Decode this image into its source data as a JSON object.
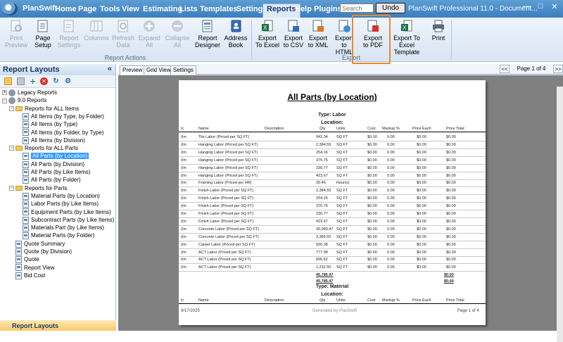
{
  "app": {
    "name": "PlanSwift",
    "window_title": "PlanSwift Professional 11.0 - Document...",
    "menu": [
      "Home",
      "Page",
      "Tools",
      "View",
      "Estimating",
      "Lists",
      "Templates",
      "Settings",
      "Reports",
      "Help",
      "Plugins"
    ],
    "search_placeholder": "Search",
    "undo_label": "Undo"
  },
  "ribbon": {
    "report_actions": {
      "label": "Report Actions",
      "buttons": [
        {
          "label": "Print Preview",
          "icon": "print-preview-icon",
          "disabled": true
        },
        {
          "label": "Page Setup",
          "icon": "page-setup-icon",
          "disabled": false
        },
        {
          "label": "Report Settings",
          "icon": "report-settings-icon",
          "disabled": true
        },
        {
          "label": "Columns",
          "icon": "columns-icon",
          "disabled": true
        },
        {
          "label": "Refresh Data",
          "icon": "refresh-icon",
          "disabled": true
        },
        {
          "label": "Expand All",
          "icon": "expand-all-icon",
          "disabled": true
        },
        {
          "label": "Collapse All",
          "icon": "collapse-all-icon",
          "disabled": true
        },
        {
          "label": "Report Designer",
          "icon": "report-designer-icon",
          "disabled": false
        },
        {
          "label": "Address Book",
          "icon": "address-book-icon",
          "disabled": false
        }
      ]
    },
    "export": {
      "label": "Export",
      "buttons": [
        {
          "label": "Export To Excel",
          "icon": "excel-icon"
        },
        {
          "label": "Export to CSV",
          "icon": "csv-icon"
        },
        {
          "label": "Export to XML",
          "icon": "xml-icon"
        },
        {
          "label": "Export to HTML",
          "icon": "html-icon"
        },
        {
          "label": "Export to PDF",
          "icon": "pdf-icon"
        },
        {
          "label": "Export To Excel Template",
          "icon": "excel-template-icon"
        },
        {
          "label": "Print",
          "icon": "printer-icon"
        }
      ]
    }
  },
  "left_pane": {
    "title": "Report Layouts",
    "bottom_label": "Report Layouts",
    "tree": [
      {
        "label": "Legacy Reports",
        "level": 0,
        "kind": "gear",
        "exp": "+"
      },
      {
        "label": "9.0 Reports",
        "level": 0,
        "kind": "gear",
        "exp": "-"
      },
      {
        "label": "Reports for ALL Items",
        "level": 1,
        "kind": "folder",
        "exp": "-"
      },
      {
        "label": "All Items (by Type, by Folder)",
        "level": 2,
        "kind": "doc"
      },
      {
        "label": "All Items (by Type)",
        "level": 2,
        "kind": "doc"
      },
      {
        "label": "All Items (by Folder, by Type)",
        "level": 2,
        "kind": "doc"
      },
      {
        "label": "All Items (by Division)",
        "level": 2,
        "kind": "doc"
      },
      {
        "label": "Reports for ALL Parts",
        "level": 1,
        "kind": "folder",
        "exp": "-"
      },
      {
        "label": "All Parts (by Location)",
        "level": 2,
        "kind": "doc",
        "selected": true
      },
      {
        "label": "All Parts (by Division)",
        "level": 2,
        "kind": "doc"
      },
      {
        "label": "All Parts (by Like Items)",
        "level": 2,
        "kind": "doc"
      },
      {
        "label": "All Parts (by Folder)",
        "level": 2,
        "kind": "doc"
      },
      {
        "label": "Reports for Parts",
        "level": 1,
        "kind": "folder",
        "exp": "-"
      },
      {
        "label": "Material Parts (by Location)",
        "level": 2,
        "kind": "doc"
      },
      {
        "label": "Labor Parts (by Like Items)",
        "level": 2,
        "kind": "doc"
      },
      {
        "label": "Equipment Parts (by Like Items)",
        "level": 2,
        "kind": "doc"
      },
      {
        "label": "Subcontract Parts (by Like Items)",
        "level": 2,
        "kind": "doc"
      },
      {
        "label": "Materials Part (by Like Items)",
        "level": 2,
        "kind": "doc"
      },
      {
        "label": "Material Parts (by Folder)",
        "level": 2,
        "kind": "doc"
      },
      {
        "label": "Quote Summary",
        "level": 1,
        "kind": "doc"
      },
      {
        "label": "Quote (by Division)",
        "level": 1,
        "kind": "doc"
      },
      {
        "label": "Quote",
        "level": 1,
        "kind": "doc"
      },
      {
        "label": "Report View",
        "level": 1,
        "kind": "doc"
      },
      {
        "label": "Bid Cost",
        "level": 1,
        "kind": "doc"
      }
    ]
  },
  "viewer": {
    "tabs": [
      "Preview",
      "Grid View",
      "Settings"
    ],
    "prev": "<<",
    "next": ">>",
    "page_indicator": "Page 1 of 4"
  },
  "report": {
    "title": "All Parts (by Location)",
    "type1": "Type: Labor",
    "location1": "Location:",
    "columns": [
      "Ic",
      "Name",
      "Description",
      "Qty",
      "Units",
      "Cost",
      "Markup %",
      "Price Each",
      "Price Total"
    ],
    "rows": [
      [
        "(Im",
        "Tile Labor (Priced per SQ FT)",
        "942.34",
        "SQ FT",
        "$0.00",
        "0.00",
        "$0.00",
        "$0.00"
      ],
      [
        "(Im",
        "Hanging Labor (Priced per SQ FT)",
        "2,384.55",
        "SQ FT",
        "$0.00",
        "0.00",
        "$0.00",
        "$0.00"
      ],
      [
        "(Im",
        "Hanging Labor (Priced per SQ FT)",
        "254.16",
        "SQ FT",
        "$0.00",
        "0.00",
        "$0.00",
        "$0.00"
      ],
      [
        "(Im",
        "Hanging Labor (Priced per SQ FT)",
        "376.75",
        "SQ FT",
        "$0.00",
        "0.00",
        "$0.00",
        "$0.00"
      ],
      [
        "(Im",
        "Hanging Labor (Priced per SQ FT)",
        "230.77",
        "SQ FT",
        "$0.00",
        "0.00",
        "$0.00",
        "$0.00"
      ],
      [
        "(Im",
        "Hanging Labor (Priced per SQ FT)",
        "423.67",
        "SQ FT",
        "$0.00",
        "0.00",
        "$0.00",
        "$0.00"
      ],
      [
        "(Im",
        "Framing Labor (Priced per HR)",
        "30.46",
        "Hour(s)",
        "$0.00",
        "0.00",
        "$0.00",
        "$0.00"
      ],
      [
        "(Im",
        "Finish Labor (Priced per SQ FT)",
        "2,384.55",
        "SQ FT",
        "$0.00",
        "0.00",
        "$0.00",
        "$0.00"
      ],
      [
        "(Im",
        "Finish Labor (Priced per SQ FT)",
        "254.16",
        "SQ FT",
        "$0.00",
        "0.00",
        "$0.00",
        "$0.00"
      ],
      [
        "(Im",
        "Finish Labor (Priced per SQ FT)",
        "376.75",
        "SQ FT",
        "$0.00",
        "0.00",
        "$0.00",
        "$0.00"
      ],
      [
        "(Im",
        "Finish Labor (Priced per SQ FT)",
        "230.77",
        "SQ FT",
        "$0.00",
        "0.00",
        "$0.00",
        "$0.00"
      ],
      [
        "(Im",
        "Finish Labor (Priced per SQ FT)",
        "423.67",
        "SQ FT",
        "$0.00",
        "0.00",
        "$0.00",
        "$0.00"
      ],
      [
        "(Im",
        "Concrete Labor (Priced per SQ FT)",
        "30,983.47",
        "SQ FT",
        "$0.00",
        "0.00",
        "$0.00",
        "$0.00"
      ],
      [
        "(Im",
        "Concrete Labor (Priced per SQ FT)",
        "3,389.92",
        "SQ FT",
        "$0.00",
        "0.00",
        "$0.00",
        "$0.00"
      ],
      [
        "(Im",
        "Carpet Labor (Priced per SQ FT)",
        "500.38",
        "SQ FT",
        "$0.00",
        "0.00",
        "$0.00",
        "$0.00"
      ],
      [
        "(Im",
        "ACT Labor (Priced per SQ FT)",
        "777.98",
        "SQ FT",
        "$0.00",
        "0.00",
        "$0.00",
        "$0.00"
      ],
      [
        "(Im",
        "ACT Labor (Priced per SQ FT)",
        "606.62",
        "SQ FT",
        "$0.00",
        "0.00",
        "$0.00",
        "$0.00"
      ],
      [
        "(Im",
        "ACT Labor (Priced per SQ FT)",
        "1,232.50",
        "SQ FT",
        "$0.00",
        "0.00",
        "$0.00",
        "$0.00"
      ]
    ],
    "total_qty_1": "45,785.47",
    "total_price_1": "$0.00",
    "total_qty_2": "45,785.47",
    "total_price_2": "$0.00",
    "type2": "Type: Material",
    "location2": "Location:",
    "footer_date": "9/17/2025",
    "footer_gen": "Generated by PlanSwift",
    "footer_page": "Page 1 of 4"
  }
}
